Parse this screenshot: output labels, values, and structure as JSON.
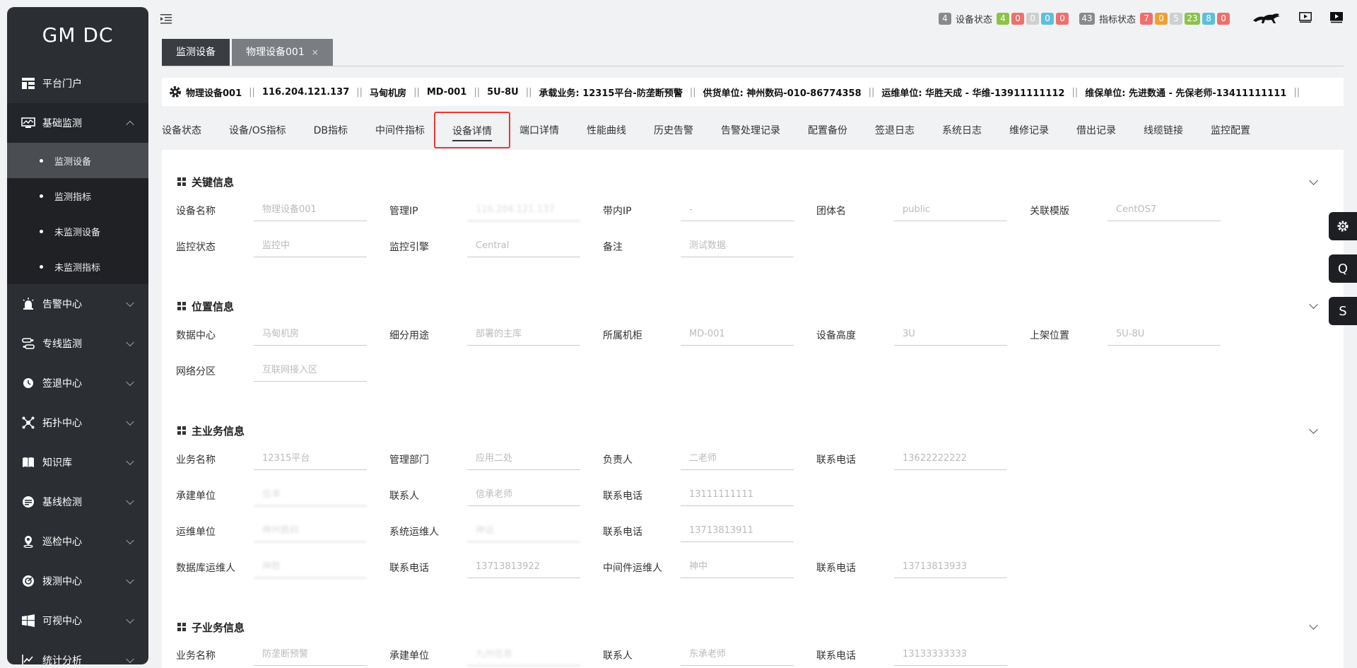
{
  "app": {
    "logo": "GM DC"
  },
  "sidebar": {
    "items": [
      {
        "label": "平台门户",
        "icon": "portal-icon",
        "expandable": false
      },
      {
        "label": "基础监测",
        "icon": "monitor-icon",
        "expandable": true,
        "expanded": true,
        "children": [
          {
            "label": "监测设备",
            "active": true
          },
          {
            "label": "监测指标"
          },
          {
            "label": "未监测设备"
          },
          {
            "label": "未监测指标"
          }
        ]
      },
      {
        "label": "告警中心",
        "icon": "alarm-icon",
        "expandable": true
      },
      {
        "label": "专线监测",
        "icon": "line-icon",
        "expandable": true
      },
      {
        "label": "签退中心",
        "icon": "clock-icon",
        "expandable": true
      },
      {
        "label": "拓扑中心",
        "icon": "topology-icon",
        "expandable": true
      },
      {
        "label": "知识库",
        "icon": "book-icon",
        "expandable": true
      },
      {
        "label": "基线检测",
        "icon": "baseline-icon",
        "expandable": true
      },
      {
        "label": "巡检中心",
        "icon": "location-icon",
        "expandable": true
      },
      {
        "label": "拨测中心",
        "icon": "dial-icon",
        "expandable": true
      },
      {
        "label": "可视中心",
        "icon": "windows-icon",
        "expandable": true
      },
      {
        "label": "统计分析",
        "icon": "chart-icon",
        "expandable": true
      }
    ]
  },
  "header": {
    "device_status": {
      "count": "4",
      "label": "设备状态",
      "badges": [
        "4",
        "0",
        "0",
        "0",
        "0"
      ]
    },
    "metric_status": {
      "count": "43",
      "label": "指标状态",
      "badges": [
        "7",
        "0",
        "5",
        "23",
        "8",
        "0"
      ]
    },
    "colors": {
      "grey": "#8a8a8a",
      "green": "#8bc34a",
      "red": "#ef6f6c",
      "light": "#cfcfcf",
      "cyan": "#5bc0de",
      "orange": "#f0a030"
    }
  },
  "tabs": [
    {
      "label": "监测设备",
      "active": true
    },
    {
      "label": "物理设备001",
      "active": false,
      "close": "×"
    }
  ],
  "device_bar": {
    "items": [
      "物理设备001",
      "116.204.121.137",
      "马甸机房",
      "MD-001",
      "5U-8U",
      "承载业务:  12315平台-防垄断预警",
      "供货单位:  神州数码-010-86774358",
      "运维单位:  华胜天成 - 华维-13911111112",
      "维保单位:  先进数通 - 先保老师-13411111111"
    ],
    "sep": "||"
  },
  "subtabs": [
    "设备状态",
    "设备/OS指标",
    "DB指标",
    "中间件指标",
    "设备详情",
    "端口详情",
    "性能曲线",
    "历史告警",
    "告警处理记录",
    "配置备份",
    "签退日志",
    "系统日志",
    "维修记录",
    "借出记录",
    "线缆链接",
    "监控配置"
  ],
  "sections": {
    "key": {
      "title": "关键信息",
      "fields": [
        {
          "label": "设备名称",
          "value": "物理设备001"
        },
        {
          "label": "管理IP",
          "value": "116.204.121.137",
          "blur": true
        },
        {
          "label": "带内IP",
          "value": "-"
        },
        {
          "label": "团体名",
          "value": "public"
        },
        {
          "label": "关联模版",
          "value": "CentOS7"
        },
        {
          "label": "监控状态",
          "value": "监控中"
        },
        {
          "label": "监控引擎",
          "value": "Central"
        },
        {
          "label": "备注",
          "value": "测试数据"
        }
      ]
    },
    "location": {
      "title": "位置信息",
      "fields": [
        {
          "label": "数据中心",
          "value": "马甸机房"
        },
        {
          "label": "细分用途",
          "value": "部署的主库"
        },
        {
          "label": "所属机柜",
          "value": "MD-001"
        },
        {
          "label": "设备高度",
          "value": "3U"
        },
        {
          "label": "上架位置",
          "value": "5U-8U"
        },
        {
          "label": "网络分区",
          "value": "互联网接入区"
        }
      ]
    },
    "main_biz": {
      "title": "主业务信息",
      "fields": [
        {
          "label": "业务名称",
          "value": "12315平台"
        },
        {
          "label": "管理部门",
          "value": "应用二处"
        },
        {
          "label": "负责人",
          "value": "二老师"
        },
        {
          "label": "联系电话",
          "value": "13622222222"
        },
        {
          "label": "承建单位",
          "value": "信承",
          "blur": true
        },
        {
          "label": "联系人",
          "value": "信承老师"
        },
        {
          "label": "联系电话",
          "value": "13111111111"
        },
        {
          "label": "运维单位",
          "value": "神州数码",
          "blur": true
        },
        {
          "label": "系统运维人",
          "value": "神运",
          "blur": true
        },
        {
          "label": "联系电话",
          "value": "13713813911"
        },
        {
          "label": "数据库运维人",
          "value": "神数",
          "blur": true
        },
        {
          "label": "联系电话",
          "value": "13713813922"
        },
        {
          "label": "中间件运维人",
          "value": "神中"
        },
        {
          "label": "联系电话",
          "value": "13713813933"
        }
      ]
    },
    "sub_biz": {
      "title": "子业务信息",
      "fields": [
        {
          "label": "业务名称",
          "value": "防垄断预警"
        },
        {
          "label": "承建单位",
          "value": "九州信息",
          "blur": true
        },
        {
          "label": "联系人",
          "value": "东承老师"
        },
        {
          "label": "联系电话",
          "value": "13133333333"
        }
      ]
    }
  },
  "float_buttons": [
    {
      "label": "",
      "icon": "settings-icon"
    },
    {
      "label": "Q"
    },
    {
      "label": "S"
    }
  ]
}
